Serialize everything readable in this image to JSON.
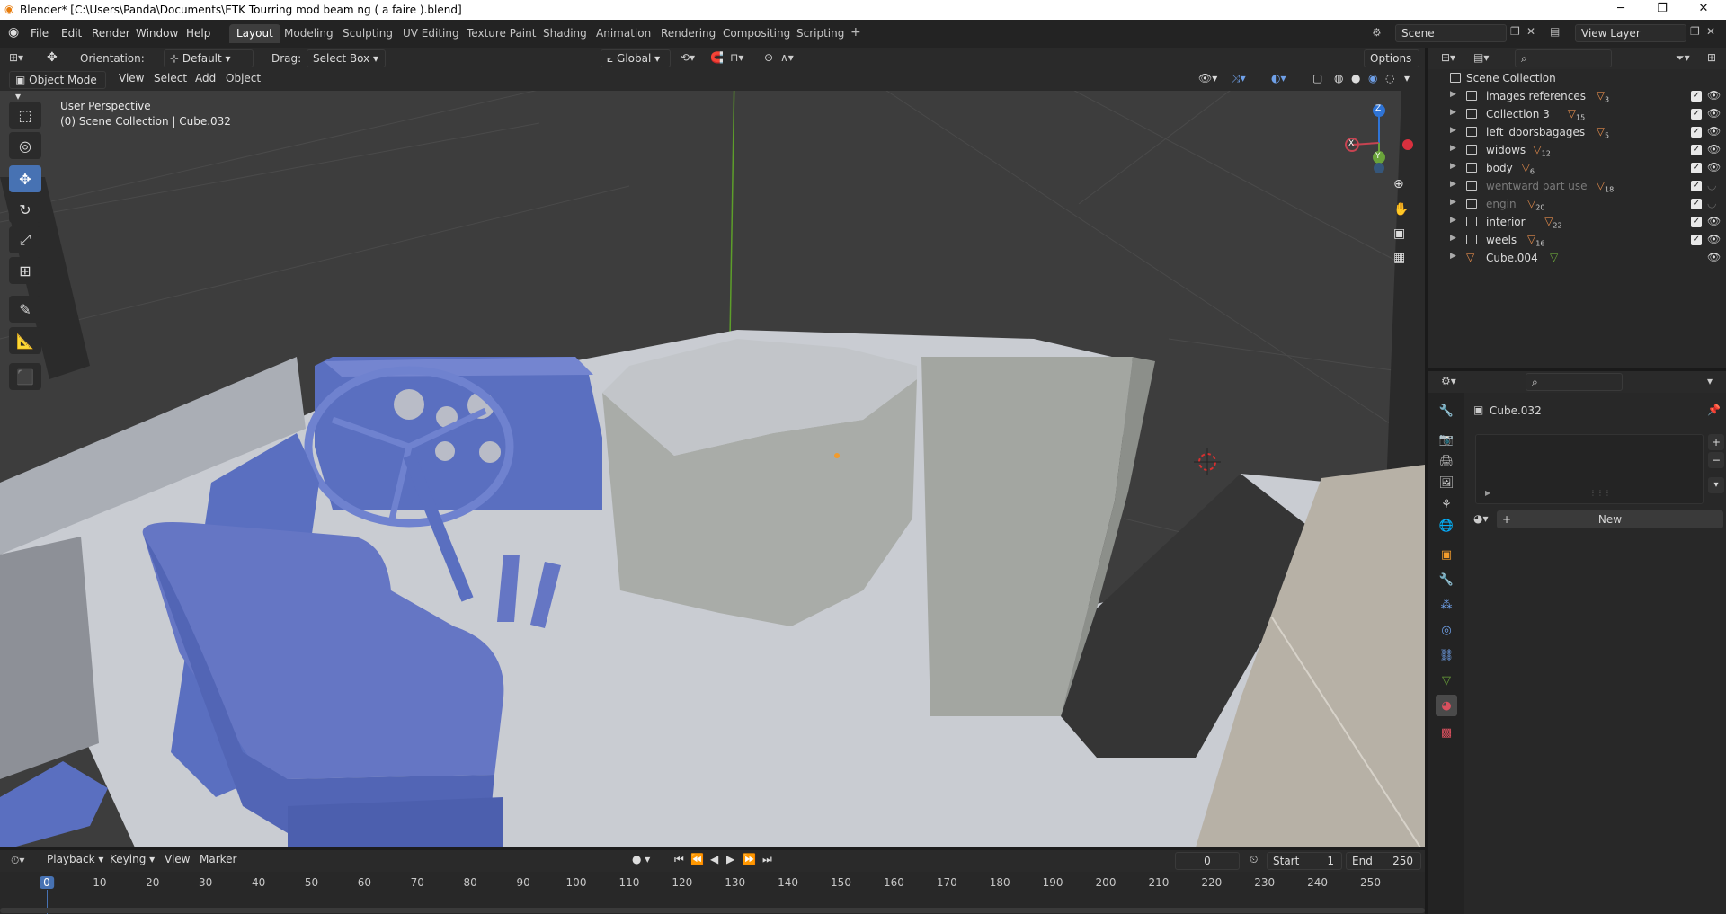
{
  "window": {
    "title": "Blender* [C:\\Users\\Panda\\Documents\\ETK Tourring mod beam ng ( a faire ).blend]",
    "minimize": "─",
    "maximize": "❐",
    "close": "✕"
  },
  "menubar": {
    "items": [
      "File",
      "Edit",
      "Render",
      "Window",
      "Help"
    ],
    "workspaces": [
      "Layout",
      "Modeling",
      "Sculpting",
      "UV Editing",
      "Texture Paint",
      "Shading",
      "Animation",
      "Rendering",
      "Compositing",
      "Scripting"
    ],
    "active_workspace": "Layout",
    "add_tab": "+",
    "scene": "Scene",
    "view_layer": "View Layer"
  },
  "tool_header": {
    "orientation_label": "Orientation:",
    "orientation_value": "Default",
    "drag_label": "Drag:",
    "drag_value": "Select Box",
    "transform_space": "Global",
    "options": "Options"
  },
  "viewport_header": {
    "mode": "Object Mode",
    "menus": [
      "View",
      "Select",
      "Add",
      "Object"
    ]
  },
  "viewport": {
    "perspective": "User Perspective",
    "collection_info": "(0) Scene Collection | Cube.032",
    "gizmo_axes": {
      "x": "X",
      "y": "Y",
      "z": "Z"
    }
  },
  "toolbar": {
    "tools": [
      "select-box-icon",
      "cursor-icon",
      "move-icon",
      "rotate-icon",
      "scale-icon",
      "transform-icon",
      "annotate-icon",
      "measure-icon",
      "add-cube-icon"
    ],
    "active_tool": "move-icon"
  },
  "outliner": {
    "root": "Scene Collection",
    "items": [
      {
        "label": "images references",
        "badge": "3",
        "dim": false,
        "checked": true,
        "visible": true
      },
      {
        "label": "Collection 3",
        "badge": "15",
        "dim": false,
        "checked": true,
        "visible": true
      },
      {
        "label": "left_doorsbagages",
        "badge": "5",
        "dim": false,
        "checked": true,
        "visible": true
      },
      {
        "label": "widows",
        "badge": "12",
        "dim": false,
        "checked": true,
        "visible": true
      },
      {
        "label": "body",
        "badge": "6",
        "dim": false,
        "checked": true,
        "visible": true
      },
      {
        "label": "wentward part use",
        "badge": "18",
        "dim": true,
        "checked": true,
        "visible": false
      },
      {
        "label": "engin",
        "badge": "20",
        "dim": true,
        "checked": true,
        "visible": false
      },
      {
        "label": "interior",
        "badge": "22",
        "dim": false,
        "checked": true,
        "visible": true
      },
      {
        "label": "weels",
        "badge": "16",
        "dim": false,
        "checked": true,
        "visible": true
      },
      {
        "label": "Cube.004",
        "badge": "",
        "dim": false,
        "checked": false,
        "visible": true
      }
    ]
  },
  "properties": {
    "object_name": "Cube.032",
    "new_button": "New"
  },
  "timeline": {
    "menus": [
      "Playback",
      "Keying",
      "View",
      "Marker"
    ],
    "current_frame": "0",
    "start_label": "Start",
    "start_value": "1",
    "end_label": "End",
    "end_value": "250",
    "ticks": [
      "0",
      "10",
      "20",
      "30",
      "40",
      "50",
      "60",
      "70",
      "80",
      "90",
      "100",
      "110",
      "120",
      "130",
      "140",
      "150",
      "160",
      "170",
      "180",
      "190",
      "200",
      "210",
      "220",
      "230",
      "240",
      "250"
    ]
  },
  "colors": {
    "accent": "#4772b3",
    "viewport_bg": "#3d3d3d",
    "model_blue": "#6b7fc7",
    "model_grey": "#c9ccd2",
    "collection_orange": "#e08a4b"
  }
}
